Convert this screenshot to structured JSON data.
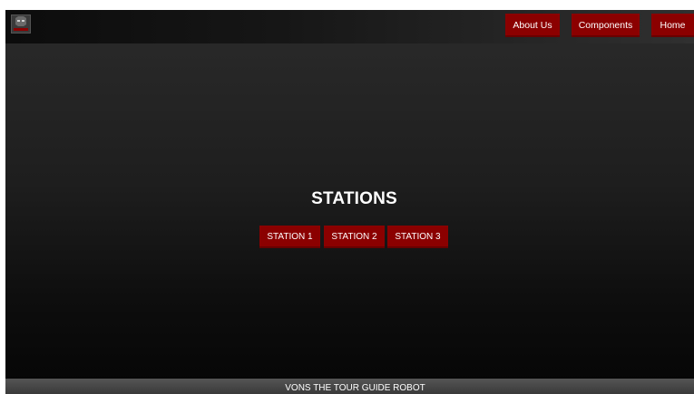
{
  "logo": {
    "name": "vons-logo-icon",
    "text": "VONS"
  },
  "nav": {
    "about_label": "About Us",
    "components_label": "Components",
    "home_label": "Home"
  },
  "main": {
    "title": "STATIONS",
    "stations": [
      "STATION 1",
      "STATION 2",
      "STATION 3"
    ]
  },
  "footer": {
    "text": "VONS THE TOUR GUIDE ROBOT"
  },
  "colors": {
    "accent": "#8b0000",
    "background_top": "#2b2b2b",
    "background_bottom": "#050505",
    "footer_bg": "#4a4a4a"
  }
}
